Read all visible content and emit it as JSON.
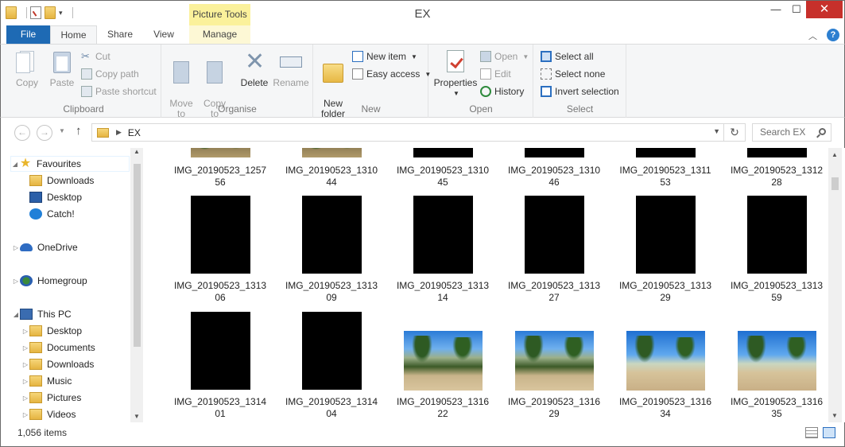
{
  "window": {
    "title": "EX",
    "context_tab": "Picture Tools",
    "minimize": "—",
    "maximize": "☐",
    "close": "✕"
  },
  "ribbon_tabs": [
    "File",
    "Home",
    "Share",
    "View",
    "Manage"
  ],
  "ribbon": {
    "clipboard": {
      "label": "Clipboard",
      "copy": "Copy",
      "paste": "Paste",
      "cut": "Cut",
      "copy_path": "Copy path",
      "paste_shortcut": "Paste shortcut"
    },
    "organise": {
      "label": "Organise",
      "move_to": "Move\nto",
      "copy_to": "Copy\nto",
      "delete": "Delete",
      "rename": "Rename"
    },
    "new": {
      "label": "New",
      "new_folder": "New\nfolder",
      "new_item": "New item",
      "easy_access": "Easy access"
    },
    "open": {
      "label": "Open",
      "properties": "Properties",
      "open": "Open",
      "edit": "Edit",
      "history": "History"
    },
    "select": {
      "label": "Select",
      "select_all": "Select all",
      "select_none": "Select none",
      "invert_selection": "Invert selection"
    }
  },
  "address": {
    "path": "EX",
    "search_placeholder": "Search EX"
  },
  "nav_pane": {
    "favourites": "Favourites",
    "fav_items": [
      "Downloads",
      "Desktop",
      "Catch!"
    ],
    "onedrive": "OneDrive",
    "homegroup": "Homegroup",
    "this_pc": "This PC",
    "pc_items": [
      "Desktop",
      "Documents",
      "Downloads",
      "Music",
      "Pictures",
      "Videos"
    ]
  },
  "files": [
    {
      "name": "IMG_20190523_1257\n56",
      "thumb": "partial"
    },
    {
      "name": "IMG_20190523_1310\n44",
      "thumb": "partial"
    },
    {
      "name": "IMG_20190523_1310\n45",
      "thumb": "partial-black"
    },
    {
      "name": "IMG_20190523_1310\n46",
      "thumb": "partial-black"
    },
    {
      "name": "IMG_20190523_1311\n53",
      "thumb": "partial-black"
    },
    {
      "name": "IMG_20190523_1312\n28",
      "thumb": "partial-black"
    },
    {
      "name": "IMG_20190523_1313\n06",
      "thumb": "black"
    },
    {
      "name": "IMG_20190523_1313\n09",
      "thumb": "black"
    },
    {
      "name": "IMG_20190523_1313\n14",
      "thumb": "black"
    },
    {
      "name": "IMG_20190523_1313\n27",
      "thumb": "black"
    },
    {
      "name": "IMG_20190523_1313\n29",
      "thumb": "black"
    },
    {
      "name": "IMG_20190523_1313\n59",
      "thumb": "black"
    },
    {
      "name": "IMG_20190523_1314\n01",
      "thumb": "black"
    },
    {
      "name": "IMG_20190523_1314\n04",
      "thumb": "black"
    },
    {
      "name": "IMG_20190523_1316\n22",
      "thumb": "photo"
    },
    {
      "name": "IMG_20190523_1316\n29",
      "thumb": "photo"
    },
    {
      "name": "IMG_20190523_1316\n34",
      "thumb": "sky"
    },
    {
      "name": "IMG_20190523_1316\n35",
      "thumb": "sky"
    }
  ],
  "status": {
    "item_count": "1,056 items"
  },
  "icons": {
    "up": "↑",
    "back": "←",
    "forward": "→",
    "refresh": "↻",
    "help": "?"
  }
}
